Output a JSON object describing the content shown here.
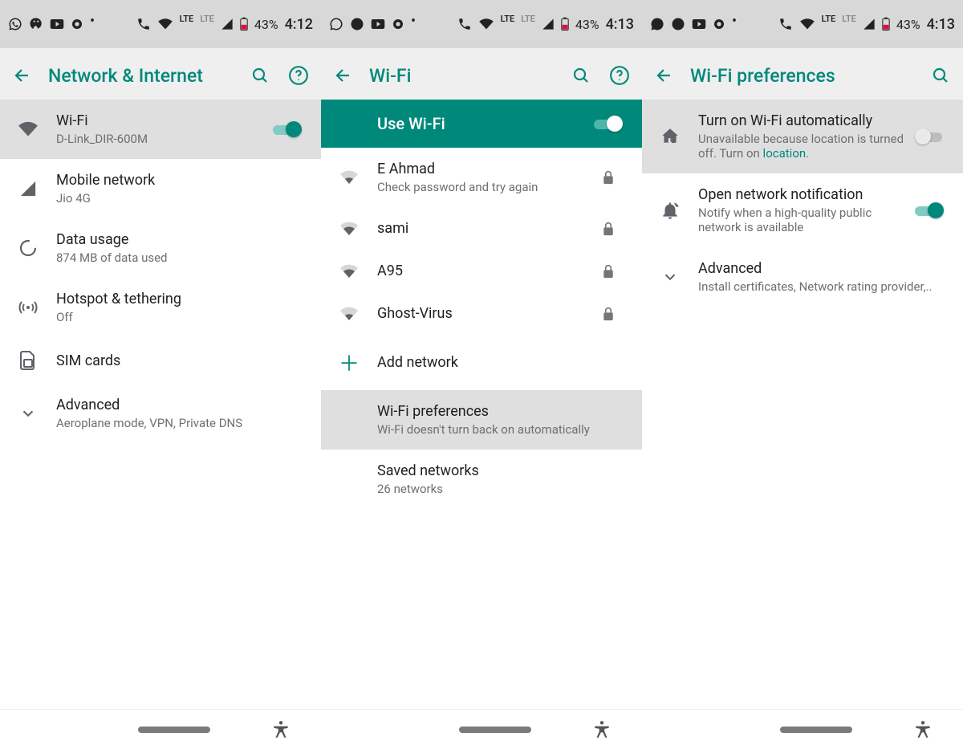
{
  "status": {
    "battery_pct": "43%",
    "time1": "4:12",
    "time2": "4:13",
    "time3": "4:13",
    "lte": "LTE"
  },
  "screen1": {
    "title": "Network & Internet",
    "wifi": {
      "label": "Wi-Fi",
      "subtitle": "D-Link_DIR-600M"
    },
    "mobile": {
      "label": "Mobile network",
      "subtitle": "Jio 4G"
    },
    "data_usage": {
      "label": "Data usage",
      "subtitle": "874 MB of data used"
    },
    "hotspot": {
      "label": "Hotspot & tethering",
      "subtitle": "Off"
    },
    "sim": {
      "label": "SIM cards"
    },
    "advanced": {
      "label": "Advanced",
      "subtitle": "Aeroplane mode, VPN, Private DNS"
    }
  },
  "screen2": {
    "title": "Wi-Fi",
    "use_wifi": "Use Wi-Fi",
    "networks": [
      {
        "name": "E Ahmad",
        "subtitle": "Check password and try again",
        "secured": true
      },
      {
        "name": "sami",
        "subtitle": "",
        "secured": true
      },
      {
        "name": "A95",
        "subtitle": "",
        "secured": true
      },
      {
        "name": "Ghost-Virus",
        "subtitle": "",
        "secured": true
      }
    ],
    "add_network": "Add network",
    "wifi_prefs": {
      "label": "Wi-Fi preferences",
      "subtitle": "Wi-Fi doesn't turn back on automatically"
    },
    "saved": {
      "label": "Saved networks",
      "subtitle": "26 networks"
    }
  },
  "screen3": {
    "title": "Wi-Fi preferences",
    "auto_on": {
      "label": "Turn on Wi-Fi automatically",
      "sub_prefix": "Unavailable because location is turned off. Turn on ",
      "link": "location",
      "sub_suffix": "."
    },
    "open_net": {
      "label": "Open network notification",
      "subtitle": "Notify when a high-quality public network is available"
    },
    "advanced": {
      "label": "Advanced",
      "subtitle": "Install certificates, Network rating provider,.."
    }
  }
}
